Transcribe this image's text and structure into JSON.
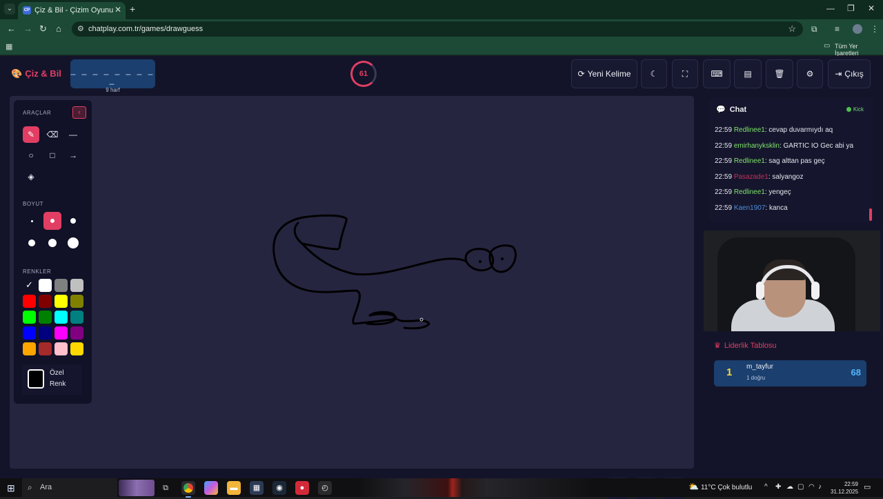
{
  "browser": {
    "tab_title": "Çiz & Bil - Çizim Oyunu",
    "tab_favicon": "CP",
    "url": "chatplay.com.tr/games/drawguess",
    "bookmarks_label": "Tüm Yer İşaretleri"
  },
  "header": {
    "logo_text": "Çiz & Bil",
    "word_mask": "_ _ _ _ _ _ _ _ _",
    "word_hint": "9 harf",
    "timer": "61",
    "new_word_label": "Yeni Kelime",
    "exit_label": "Çıkış",
    "icons": [
      "moon-icon",
      "fullscreen-icon",
      "keyboard-icon",
      "archive-icon",
      "trash-icon",
      "gear-icon"
    ]
  },
  "tools": {
    "section_tools": "ARAÇLAR",
    "section_size": "BOYUT",
    "section_colors": "RENKLER",
    "custom_color_label_1": "Özel",
    "custom_color_label_2": "Renk",
    "tool_names": [
      "brush",
      "eraser",
      "line",
      "circle",
      "rectangle",
      "arrow",
      "fill"
    ],
    "active_tool": "brush",
    "active_size": 2,
    "colors": [
      "#000000",
      "#ffffff",
      "#808080",
      "#c0c0c0",
      "#ff0000",
      "#800000",
      "#ffff00",
      "#808000",
      "#00ff00",
      "#008000",
      "#00ffff",
      "#008080",
      "#0000ff",
      "#000080",
      "#ff00ff",
      "#800080",
      "#ffa500",
      "#a52a2a",
      "#ffc0cb",
      "#ffd700"
    ],
    "selected_color": "#000000"
  },
  "chat": {
    "title": "Chat",
    "status": "Kick",
    "messages": [
      {
        "time": "22:59",
        "user": "Redlinee1",
        "color": "#7ee36a",
        "text": ": cevap duvarmıydı aq"
      },
      {
        "time": "22:59",
        "user": "emirhanyksklin",
        "color": "#7ee36a",
        "text": ": GARTİC İO Gec abi ya"
      },
      {
        "time": "22:59",
        "user": "Redlinee1",
        "color": "#7ee36a",
        "text": ": sag alttan pas geç"
      },
      {
        "time": "22:59",
        "user": "Pasazade1",
        "color": "#c2305a",
        "text": ": salyangoz"
      },
      {
        "time": "22:59",
        "user": "Redlinee1",
        "color": "#7ee36a",
        "text": ": yengeç"
      },
      {
        "time": "22:59",
        "user": "Kaen1907",
        "color": "#4d8dd8",
        "text": ": kanca"
      }
    ]
  },
  "leaderboard": {
    "title": "Liderlik Tablosu",
    "rows": [
      {
        "rank": "1",
        "name": "m_tayfur",
        "sub": "1 doğru",
        "score": "68"
      }
    ]
  },
  "taskbar": {
    "search_placeholder": "Ara",
    "weather": "11°C  Çok bulutlu",
    "time": "22:59",
    "date": "31.12.2025"
  }
}
